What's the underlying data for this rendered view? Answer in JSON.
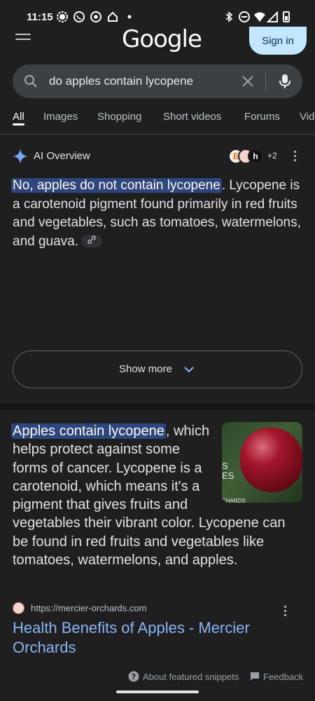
{
  "status_bar": {
    "time": "11:15"
  },
  "header": {
    "logo": "Google",
    "signin_label": "Sign in"
  },
  "search": {
    "query": "do apples contain lycopene"
  },
  "tabs": [
    {
      "label": "All",
      "active": true
    },
    {
      "label": "Images"
    },
    {
      "label": "Shopping"
    },
    {
      "label": "Short videos"
    },
    {
      "label": "Forums"
    },
    {
      "label": "Vid"
    }
  ],
  "ai_overview": {
    "title": "AI Overview",
    "sources_more": "+2",
    "highlight": "No, apples do not contain lycopene",
    "body_text": ". Lycopene is a carotenoid pigment found primarily in red fruits and vegetables, such as tomatoes, watermelons, and guava.",
    "show_more_label": "Show more",
    "favicons": [
      "E",
      "",
      "h"
    ]
  },
  "snippet": {
    "highlight": "Apples contain lycopene",
    "body_text": ", which helps protect against some forms of cancer. Lycopene is a carotenoid, which means it's a pigment that gives fruits and vegetables their vibrant color. Lycopene can be found in red fruits and vegetables like tomatoes, watermelons, and apples.",
    "image_text_line1": "S",
    "image_text_line2": "ES",
    "image_text_line3": "CHARDS",
    "source_url": "https://mercier-orchards.com",
    "title": "Health Benefits of Apples - Mercier Orchards"
  },
  "footer": {
    "about_label": "About featured snippets",
    "feedback_label": "Feedback"
  },
  "colors": {
    "accent": "#8ab4f8",
    "highlight": "#2e4680",
    "signin_bg": "#c2e7ff"
  }
}
